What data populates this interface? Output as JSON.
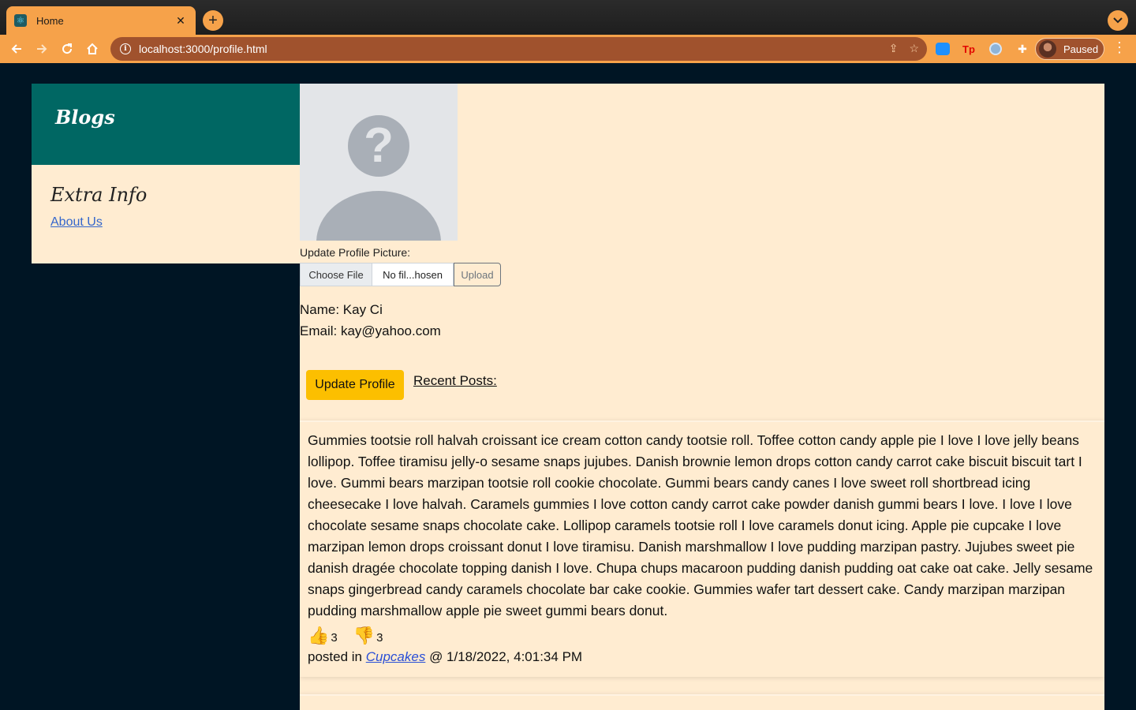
{
  "browser": {
    "tab_title": "Home",
    "tab_close": "✕",
    "new_tab": "+",
    "url": "localhost:3000/profile.html",
    "profile_status": "Paused",
    "extensions": [
      "cloud-extension-icon",
      "tp-extension-icon",
      "circle-extension-icon",
      "puzzle-extensions-icon"
    ],
    "ext_tp_label": "Tp"
  },
  "sidebar": {
    "brand": "Blogs",
    "section_title": "Extra Info",
    "links": [
      "About Us"
    ]
  },
  "profile": {
    "update_picture_label": "Update Profile Picture:",
    "choose_file_label": "Choose File",
    "file_status": "No fil...hosen",
    "upload_label": "Upload",
    "name_line": "Name: Kay Ci",
    "email_line": "Email: kay@yahoo.com",
    "update_button": "Update Profile",
    "recent_posts_title": "Recent Posts:"
  },
  "posts": [
    {
      "body": "Gummies tootsie roll halvah croissant ice cream cotton candy tootsie roll. Toffee cotton candy apple pie I love I love jelly beans lollipop. Toffee tiramisu jelly-o sesame snaps jujubes. Danish brownie lemon drops cotton candy carrot cake biscuit biscuit tart I love. Gummi bears marzipan tootsie roll cookie chocolate. Gummi bears candy canes I love sweet roll shortbread icing cheesecake I love halvah. Caramels gummies I love cotton candy carrot cake powder danish gummi bears I love. I love I love chocolate sesame snaps chocolate cake. Lollipop caramels tootsie roll I love caramels donut icing. Apple pie cupcake I love marzipan lemon drops croissant donut I love tiramisu. Danish marshmallow I love pudding marzipan pastry. Jujubes sweet pie danish dragée chocolate topping danish I love. Chupa chups macaroon pudding danish pudding oat cake oat cake. Jelly sesame snaps gingerbread candy caramels chocolate bar cake cookie. Gummies wafer tart dessert cake. Candy marzipan marzipan pudding marshmallow apple pie sweet gummi bears donut.",
      "likes": "3",
      "dislikes": "3",
      "posted_prefix": "posted in ",
      "category": "Cupcakes",
      "posted_suffix": " @ 1/18/2022, 4:01:34 PM"
    }
  ],
  "icons": {
    "like": "👍",
    "dislike": "👎"
  },
  "colors": {
    "page_bg": "#001524",
    "accent_teal": "#006763",
    "panel_cream": "#ffecd1",
    "button_yellow": "#fcbf00",
    "browser_orange": "#f6a24a"
  }
}
